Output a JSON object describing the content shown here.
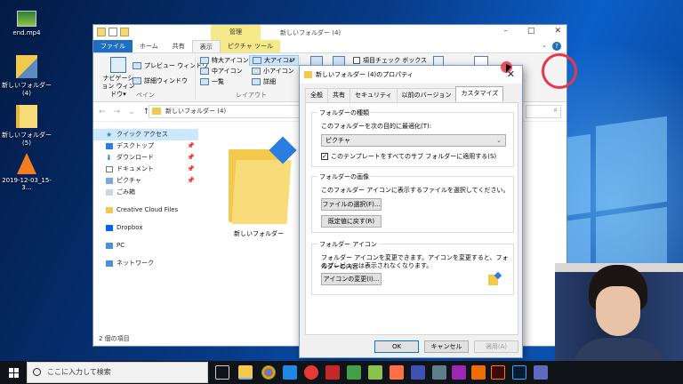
{
  "desktop": {
    "icons": [
      {
        "label": "end.mp4"
      },
      {
        "label": "新しいフォルダー (4)"
      },
      {
        "label": "新しいフォルダー (5)"
      },
      {
        "label": "2019-12-03_15-3..."
      }
    ]
  },
  "explorer": {
    "title": "新しいフォルダー (4)",
    "context_tab_group": "管理",
    "ribbon_tabs": [
      "ファイル",
      "ホーム",
      "共有",
      "表示",
      "ピクチャ ツール"
    ],
    "ribbon": {
      "navigation_pane": "ナビゲーション ウィンドウ",
      "preview_pane": "プレビュー ウィンドウ",
      "details_pane": "詳細ウィンドウ",
      "group_pane": "ペイン",
      "extra_large_icons": "特大アイコン",
      "large_icons": "大アイコン",
      "medium_icons": "中アイコン",
      "small_icons": "小アイコン",
      "list": "一覧",
      "details": "詳細",
      "group_layout": "レイアウト",
      "item_checkboxes": "項目チェック ボックス"
    },
    "address": "新しいフォルダー (4)",
    "nav": {
      "quick_access": "クイック アクセス",
      "desktop": "デスクトップ",
      "downloads": "ダウンロード",
      "documents": "ドキュメント",
      "pictures": "ピクチャ",
      "recycle_bin": "ごみ箱",
      "creative_cloud": "Creative Cloud Files",
      "dropbox": "Dropbox",
      "pc": "PC",
      "network": "ネットワーク"
    },
    "folder_item": "新しいフォルダー",
    "status": "2 個の項目"
  },
  "dialog": {
    "title": "新しいフォルダー (4)のプロパティ",
    "tabs": [
      "全般",
      "共有",
      "セキュリティ",
      "以前のバージョン",
      "カスタマイズ"
    ],
    "folder_type": {
      "legend": "フォルダーの種類",
      "optimize_label": "このフォルダーを次の目的に最適化(T):",
      "selected": "ピクチャ",
      "apply_subfolders": "このテンプレートをすべてのサブ フォルダーに適用する(S)"
    },
    "folder_pictures": {
      "legend": "フォルダーの画像",
      "desc": "このフォルダー アイコンに表示するファイルを選択してください。",
      "choose_file": "ファイルの選択(F)...",
      "restore_default": "既定値に戻す(R)"
    },
    "folder_icons": {
      "legend": "フォルダー アイコン",
      "desc1": "フォルダー アイコンを変更できます。アイコンを変更すると、フォルダーの内容",
      "desc2": "のプレビューは表示されなくなります。",
      "change_icon": "アイコンの変更(I)..."
    },
    "ok": "OK",
    "cancel": "キャンセル",
    "apply": "適用(A)"
  },
  "taskbar": {
    "search_placeholder": "ここに入力して検索"
  },
  "colors": {
    "accent": "#0078d7",
    "annotation_red": "#e8374d",
    "folder_yellow": "#f2c94c"
  }
}
